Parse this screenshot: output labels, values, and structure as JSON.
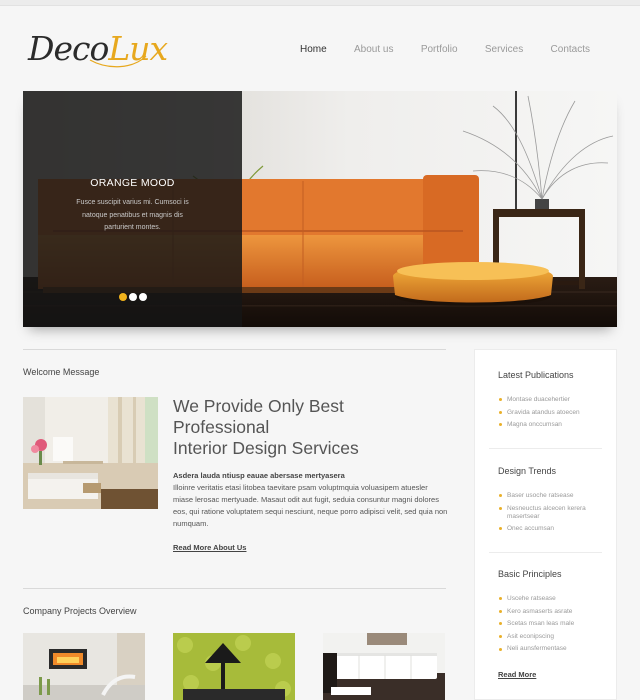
{
  "brand": {
    "part1": "Deco",
    "part2": "Lux"
  },
  "nav": [
    {
      "label": "Home",
      "active": true
    },
    {
      "label": "About us"
    },
    {
      "label": "Portfolio"
    },
    {
      "label": "Services"
    },
    {
      "label": "Contacts"
    }
  ],
  "hero": {
    "title": "ORANGE MOOD",
    "text": "Fusce suscipit varius mi. Cumsoci is natoque penatibus et magnis dis parturient montes.",
    "active_slide": 1,
    "slide_count": 3
  },
  "welcome": {
    "section_title": "Welcome Message",
    "heading": [
      "We Provide Only Best",
      "Professional",
      "Interior Design Services"
    ],
    "subheading": "Asdera lauda ntiusp eauae abersase mertyasera",
    "body": "Illoinre veritatis etasi litobea taevitare psam voluptmquia voluasipem atuesler miase lerosac mertyuade. Masaut odit aut fugit, seduia consuntur magni dolores eos, qui ratione voluptatem sequi nesciunt, neque porro adipisci velit, sed quia non numquam.",
    "read_more": "Read More About Us"
  },
  "projects": {
    "section_title": "Company Projects Overview"
  },
  "sidebar": {
    "sections": [
      {
        "title": "Latest Publications",
        "items": [
          "Montase duacehertier",
          "Gravida atandus atoecen",
          "Magna onccumsan"
        ]
      },
      {
        "title": "Design Trends",
        "items": [
          "Baser usoche ratsease",
          "Nesneuctus alcecen kerera masertsear",
          "Onec accumsan"
        ]
      },
      {
        "title": "Basic Principles",
        "items": [
          "Uscehe ratsease",
          "Kero asmaserts asrate",
          "Scetas msan leas male",
          "Asit econipscing",
          "Neli aunsfermentase"
        ]
      }
    ],
    "read_more": "Read More"
  },
  "colors": {
    "accent": "#e7a81e",
    "sofa": "#e07a2c",
    "bullet": "#e9b02a"
  }
}
